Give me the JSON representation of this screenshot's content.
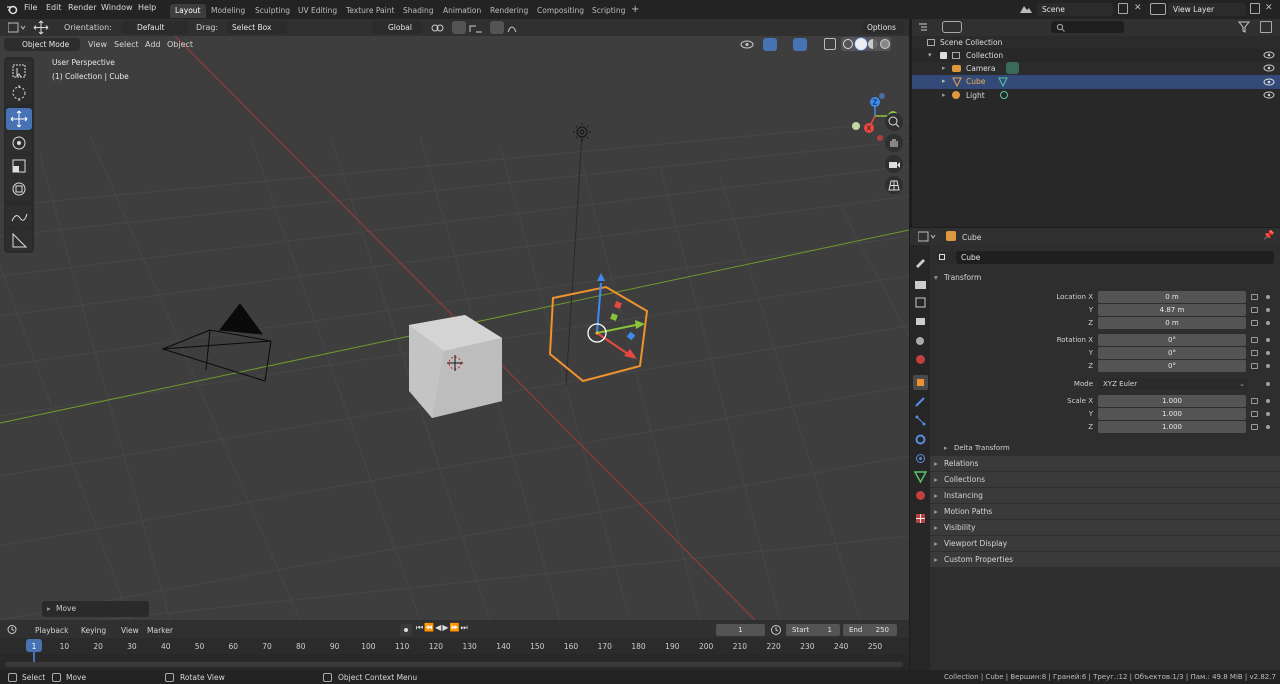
{
  "app": {
    "menus": [
      "File",
      "Edit",
      "Render",
      "Window",
      "Help"
    ],
    "workspaces": [
      "Layout",
      "Modeling",
      "Sculpting",
      "UV Editing",
      "Texture Paint",
      "Shading",
      "Animation",
      "Rendering",
      "Compositing",
      "Scripting"
    ],
    "scene": "Scene",
    "view_layer": "View Layer"
  },
  "toolheader": {
    "orientation_label": "Orientation:",
    "orientation_value": "Default",
    "drag_label": "Drag:",
    "drag_value": "Select Box",
    "transform": "Global",
    "options": "Options"
  },
  "viewheader": {
    "mode": "Object Mode",
    "menus": [
      "View",
      "Select",
      "Add",
      "Object"
    ]
  },
  "viewport": {
    "perspective": "User Perspective",
    "collection": "(1) Collection | Cube",
    "last_op": "Move"
  },
  "outliner": {
    "root": "Scene Collection",
    "collection": "Collection",
    "items": [
      {
        "name": "Camera",
        "selected": false
      },
      {
        "name": "Cube",
        "selected": true
      },
      {
        "name": "Light",
        "selected": false
      }
    ]
  },
  "properties": {
    "object": "Cube",
    "name_field": "Cube",
    "panel": "Transform",
    "location": {
      "label": "Location X",
      "x": "0 m",
      "y": "4.87 m",
      "z": "0 m"
    },
    "rotation": {
      "label": "Rotation X",
      "x": "0°",
      "y": "0°",
      "z": "0°"
    },
    "mode": {
      "label": "Mode",
      "value": "XYZ Euler"
    },
    "scale": {
      "label": "Scale X",
      "x": "1.000",
      "y": "1.000",
      "z": "1.000"
    },
    "axis_y": "Y",
    "axis_z": "Z",
    "delta": "Delta Transform",
    "sections": [
      "Relations",
      "Collections",
      "Instancing",
      "Motion Paths",
      "Visibility",
      "Viewport Display",
      "Custom Properties"
    ]
  },
  "timeline": {
    "menus": [
      "Playback",
      "Keying",
      "View",
      "Marker"
    ],
    "current_frame": "1",
    "start_label": "Start",
    "start": "1",
    "end_label": "End",
    "end": "250",
    "ticks": [
      "1",
      "10",
      "20",
      "30",
      "40",
      "50",
      "60",
      "70",
      "80",
      "90",
      "100",
      "110",
      "120",
      "130",
      "140",
      "150",
      "160",
      "170",
      "180",
      "190",
      "200",
      "210",
      "220",
      "230",
      "240",
      "250"
    ]
  },
  "status": {
    "select": "Select",
    "move": "Move",
    "rotate": "Rotate View",
    "context": "Object Context Menu",
    "info": "Collection | Cube | Вершин:8 | Граней:6 | Треуг.:12 | Объектов:1/3 | Пам.: 49.8 MiB | v2.82.7"
  }
}
